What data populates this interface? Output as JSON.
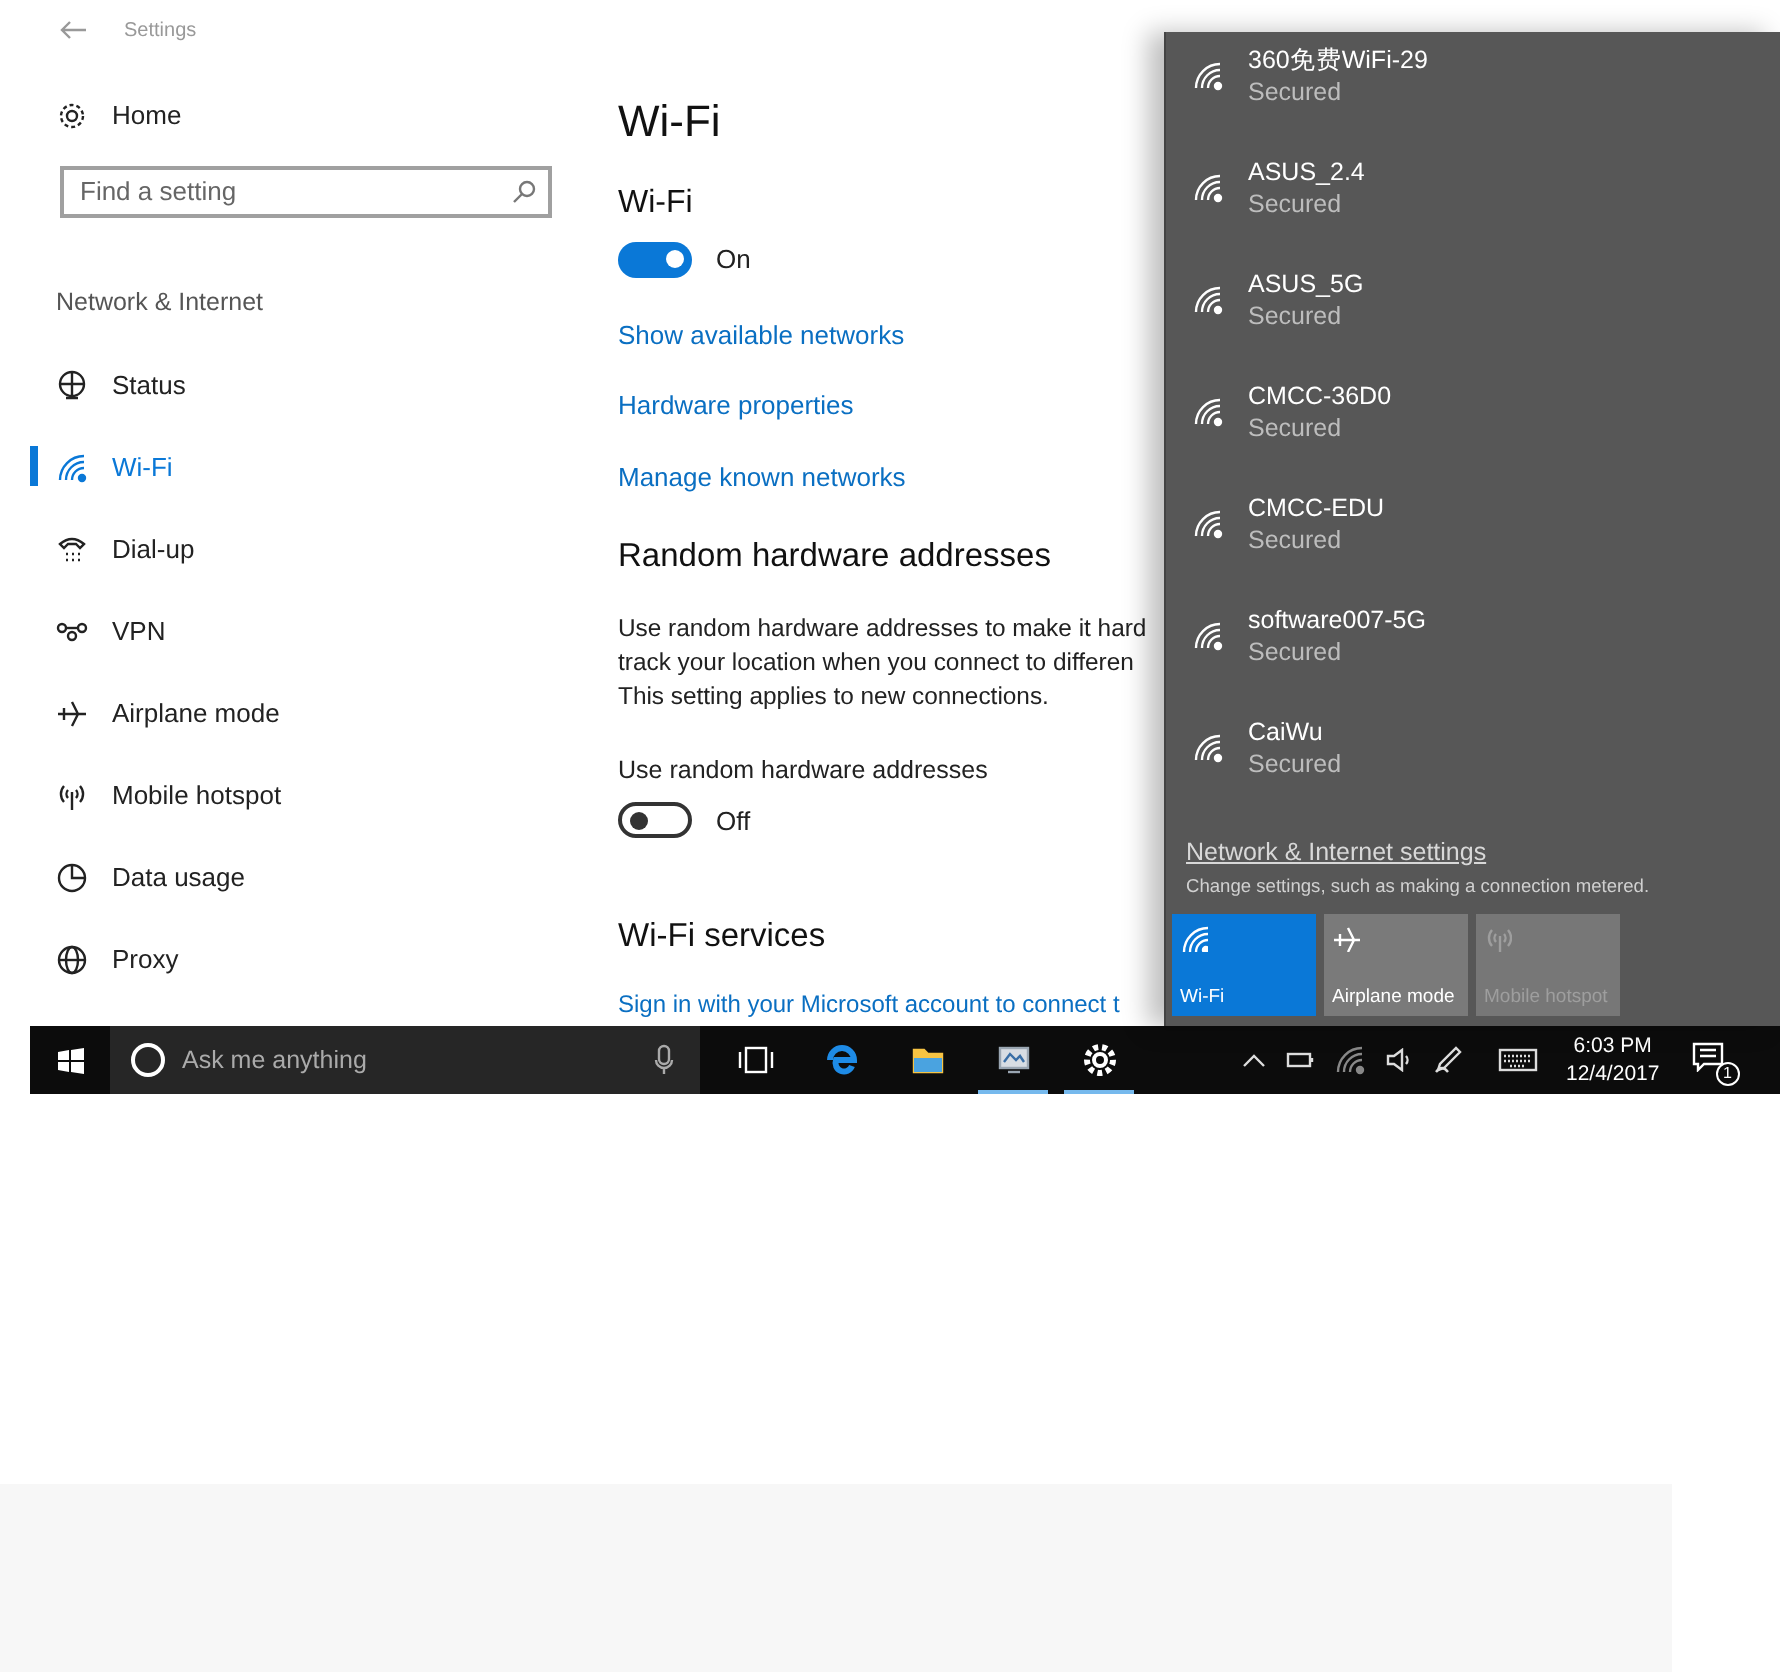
{
  "window": {
    "title": "Settings"
  },
  "sidebar": {
    "home": "Home",
    "search": {
      "placeholder": "Find a setting"
    },
    "section": "Network & Internet",
    "items": [
      {
        "kind": "status",
        "label": "Status",
        "selected": false
      },
      {
        "kind": "wifi",
        "label": "Wi-Fi",
        "selected": true
      },
      {
        "kind": "dialup",
        "label": "Dial-up",
        "selected": false
      },
      {
        "kind": "vpn",
        "label": "VPN",
        "selected": false
      },
      {
        "kind": "airplane",
        "label": "Airplane mode",
        "selected": false
      },
      {
        "kind": "hotspot",
        "label": "Mobile hotspot",
        "selected": false
      },
      {
        "kind": "data",
        "label": "Data usage",
        "selected": false
      },
      {
        "kind": "proxy",
        "label": "Proxy",
        "selected": false
      }
    ]
  },
  "content": {
    "title": "Wi-Fi",
    "wifi": {
      "heading": "Wi-Fi",
      "on": true,
      "state_label": "On"
    },
    "links": [
      "Show available networks",
      "Hardware properties",
      "Manage known networks"
    ],
    "random": {
      "heading": "Random hardware addresses",
      "description_lines": [
        "Use random hardware addresses to make it hard",
        "track your location when you connect to differen",
        "This setting applies to new connections."
      ],
      "toggle_label": "Use random hardware addresses",
      "on": false,
      "state_label": "Off"
    },
    "services": {
      "heading": "Wi-Fi services",
      "link": "Sign in with your Microsoft account to connect t"
    }
  },
  "flyout": {
    "networks": [
      {
        "name": "360免费WiFi-29",
        "status": "Secured"
      },
      {
        "name": "ASUS_2.4",
        "status": "Secured"
      },
      {
        "name": "ASUS_5G",
        "status": "Secured"
      },
      {
        "name": "CMCC-36D0",
        "status": "Secured"
      },
      {
        "name": "CMCC-EDU",
        "status": "Secured"
      },
      {
        "name": "software007-5G",
        "status": "Secured"
      },
      {
        "name": "CaiWu",
        "status": "Secured"
      }
    ],
    "settings_link": "Network & Internet settings",
    "settings_hint": "Change settings, such as making a connection metered.",
    "tiles": [
      {
        "kind": "wifi",
        "label": "Wi-Fi",
        "on": true,
        "disabled": false
      },
      {
        "kind": "airplane",
        "label": "Airplane mode",
        "on": false,
        "disabled": false
      },
      {
        "kind": "hotspot",
        "label": "Mobile hotspot",
        "on": false,
        "disabled": true
      }
    ]
  },
  "taskbar": {
    "search": {
      "placeholder": "Ask me anything"
    },
    "apps": [
      {
        "kind": "taskview",
        "running": false
      },
      {
        "kind": "edge",
        "running": false
      },
      {
        "kind": "explorer",
        "running": false
      },
      {
        "kind": "monitor",
        "running": true
      },
      {
        "kind": "settings",
        "running": true
      }
    ],
    "time": "6:03 PM",
    "date": "12/4/2017",
    "notifications": "1"
  }
}
